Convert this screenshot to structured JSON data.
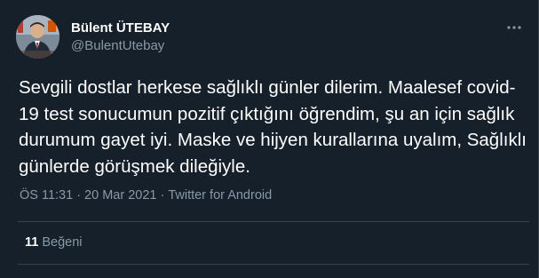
{
  "author": {
    "display_name": "Bülent ÜTEBAY",
    "handle": "@BulentUtebay",
    "avatar_icon": "profile-photo"
  },
  "tweet": {
    "text": "Sevgili dostlar herkese sağlıklı günler dilerim. Maalesef covid-19 test sonucumun pozitif çıktığını öğrendim, şu an için sağlık durumum gayet iyi. Maske ve hijyen kurallarına uyalım, Sağlıklı günlerde görüşmek dileğiyle.",
    "time": "ÖS 11:31",
    "separator": "·",
    "date": "20 Mar 2021",
    "source": "Twitter for Android"
  },
  "stats": {
    "likes_count": "11",
    "likes_label": "Beğeni"
  },
  "icons": {
    "more": "more-dots-icon"
  },
  "colors": {
    "background": "#15202b",
    "text": "#ffffff",
    "secondary": "#8899a6",
    "divider": "#38444d"
  }
}
